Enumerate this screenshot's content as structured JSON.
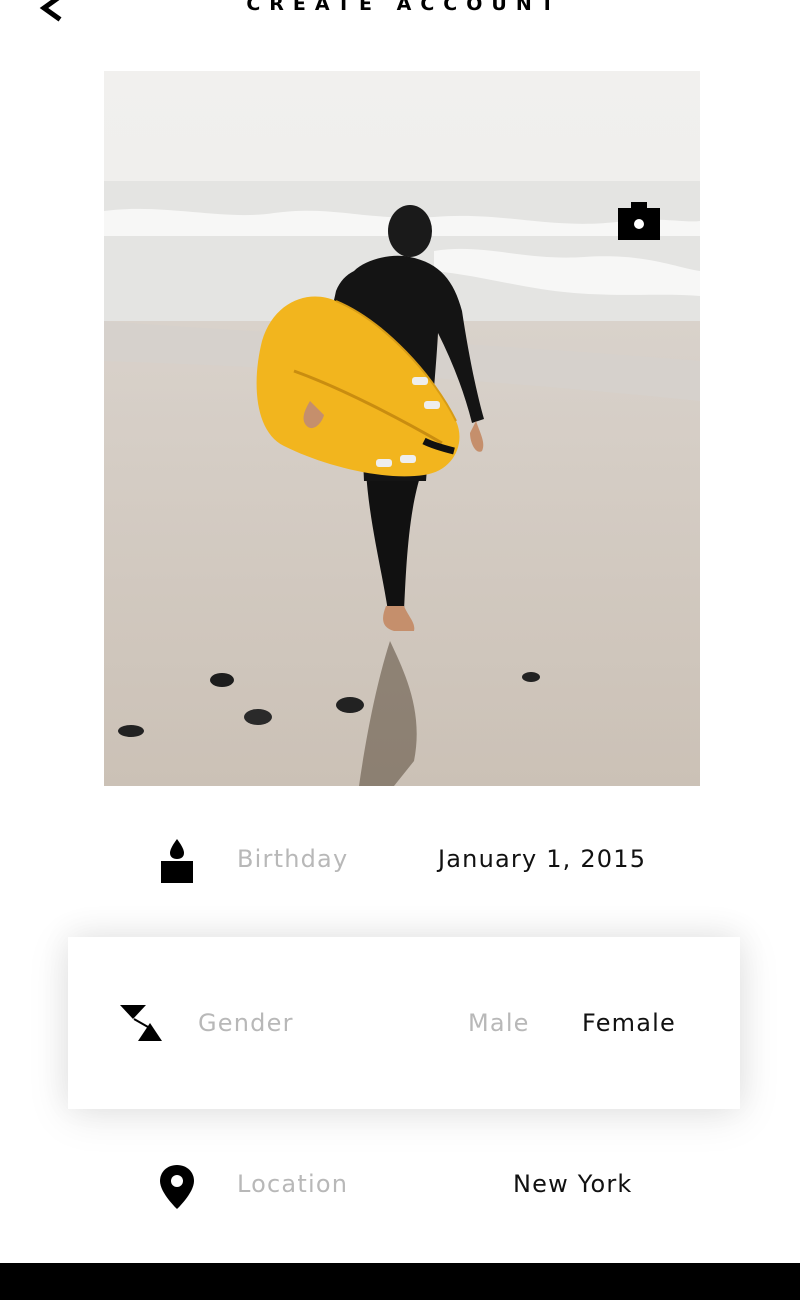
{
  "header": {
    "title": "CREATE ACCOUNT",
    "back_icon": "chevron-left-icon"
  },
  "photo": {
    "subject": "surfer-photo",
    "camera_icon": "camera-icon"
  },
  "fields": {
    "birthday": {
      "icon": "candle-icon",
      "label": "Birthday",
      "value": "January 1, 2015"
    },
    "gender": {
      "icon": "gender-icon",
      "label": "Gender",
      "options": [
        "Male",
        "Female"
      ],
      "selected": "Female"
    },
    "location": {
      "icon": "map-pin-icon",
      "label": "Location",
      "value": "New York"
    }
  },
  "colors": {
    "label_gray": "#b8b8b8",
    "text_dark": "#111111",
    "bar_black": "#000000",
    "board_yellow": "#f2b51e"
  }
}
